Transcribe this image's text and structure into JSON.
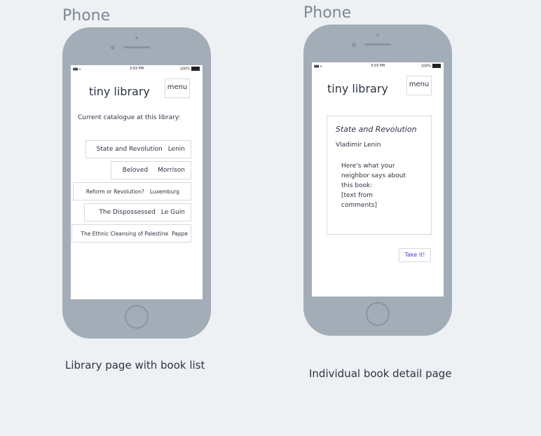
{
  "phone_label": "Phone",
  "status": {
    "time": "3:03 PM",
    "battery": "100%"
  },
  "library_page": {
    "app_title": "tiny library",
    "menu_label": "menu",
    "catalogue_label": "Current catalogue at this library:",
    "books": [
      {
        "title": "State and Revolution",
        "author": "Lenin"
      },
      {
        "title": "Beloved",
        "author": "Morrison"
      },
      {
        "title": "Reform or Revolution?",
        "author": "Luxemburg"
      },
      {
        "title": "The Dispossessed",
        "author": "Le Guin"
      },
      {
        "title": "The Ethnic Cleansing of Palestine",
        "author": "Pappe"
      }
    ],
    "caption": "Library page with book list"
  },
  "detail_page": {
    "app_title": "tiny library",
    "menu_label": "menu",
    "book_title": "State and Revolution",
    "book_author": "Vladimir Lenin",
    "blurb_lines": [
      "Here's what your",
      "neighbor says about",
      "this book:",
      "[text from",
      "comments]"
    ],
    "take_button": "Take it!",
    "caption": "Individual book detail page"
  },
  "colors": {
    "background": "#eef1f4",
    "phone_body": "#a3adb8",
    "take_button_text": "#4d3bd1"
  }
}
